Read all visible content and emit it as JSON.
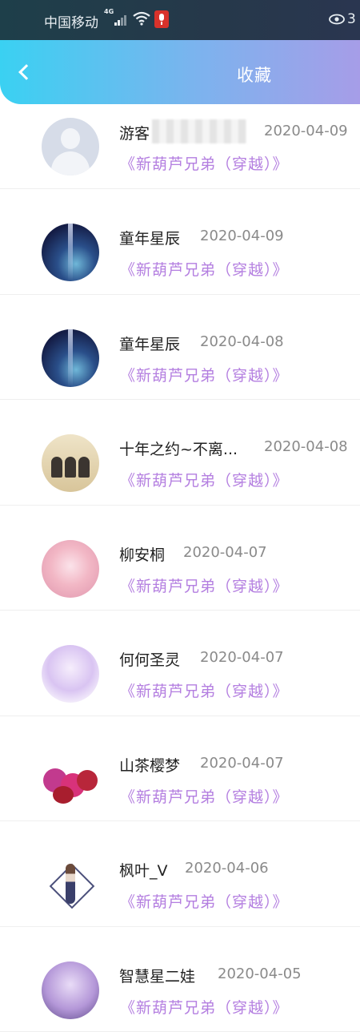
{
  "status_bar": {
    "carrier": "中国移动",
    "network": "4G",
    "time_partial": "3"
  },
  "header": {
    "title": "收藏"
  },
  "favorites": [
    {
      "name": "游客",
      "date": "2020-04-09",
      "book": "《新葫芦兄弟（穿越）》",
      "avatar": "default-avatar"
    },
    {
      "name": "童年星辰",
      "date": "2020-04-09",
      "book": "《新葫芦兄弟（穿越）》",
      "avatar": "space-avatar"
    },
    {
      "name": "童年星辰",
      "date": "2020-04-08",
      "book": "《新葫芦兄弟（穿越）》",
      "avatar": "space-avatar"
    },
    {
      "name": "十年之约~不离...",
      "date": "2020-04-08",
      "book": "《新葫芦兄弟（穿越）》",
      "avatar": "group-photo-avatar"
    },
    {
      "name": "柳安桐",
      "date": "2020-04-07",
      "book": "《新葫芦兄弟（穿越）》",
      "avatar": "pink-anime-avatar"
    },
    {
      "name": "何何圣灵",
      "date": "2020-04-07",
      "book": "《新葫芦兄弟（穿越）》",
      "avatar": "lilac-anime-avatar"
    },
    {
      "name": "山茶樱梦",
      "date": "2020-04-07",
      "book": "《新葫芦兄弟（穿越）》",
      "avatar": "flower-avatar"
    },
    {
      "name": "枫叶_V",
      "date": "2020-04-06",
      "book": "《新葫芦兄弟（穿越）》",
      "avatar": "girl-figure-avatar"
    },
    {
      "name": "智慧星二娃",
      "date": "2020-04-05",
      "book": "《新葫芦兄弟（穿越）》",
      "avatar": "purple-anime-avatar"
    }
  ]
}
